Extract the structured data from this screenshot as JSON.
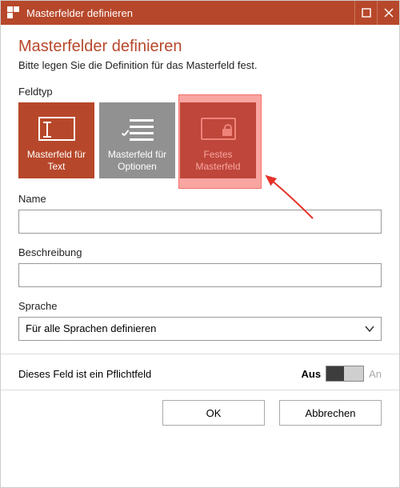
{
  "colors": {
    "accent": "#b7472a"
  },
  "window": {
    "title": "Masterfelder definieren"
  },
  "heading": "Masterfelder definieren",
  "subheading": "Bitte legen Sie die Definition für das Masterfeld fest.",
  "fieldtype": {
    "label": "Feldtyp",
    "options": [
      {
        "id": "text",
        "label": "Masterfeld für Text",
        "icon": "text-field-icon",
        "selected": true
      },
      {
        "id": "options",
        "label": "Masterfeld für Optionen",
        "icon": "options-list-icon",
        "selected": false
      },
      {
        "id": "fixed",
        "label": "Festes Masterfeld",
        "icon": "locked-field-icon",
        "selected": false
      }
    ],
    "annotation": {
      "type": "highlight+arrow",
      "target": "fixed"
    }
  },
  "fields": {
    "name": {
      "label": "Name",
      "value": ""
    },
    "description": {
      "label": "Beschreibung",
      "value": ""
    },
    "language": {
      "label": "Sprache",
      "selected": "Für alle Sprachen definieren"
    }
  },
  "mandatory": {
    "label": "Dieses Feld ist ein Pflichtfeld",
    "state_off_label": "Aus",
    "state_on_label": "An",
    "value": false
  },
  "buttons": {
    "ok": "OK",
    "cancel": "Abbrechen"
  }
}
